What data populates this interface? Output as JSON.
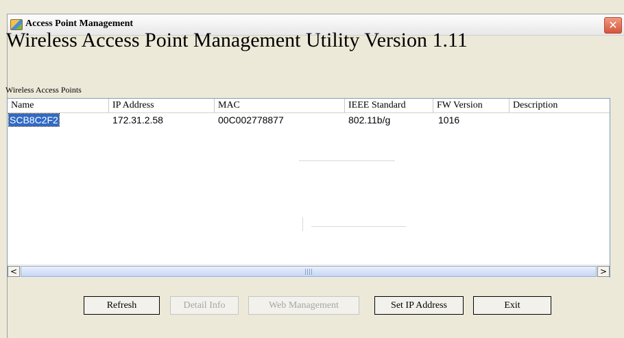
{
  "window": {
    "title": "Access Point Management",
    "close_icon": "close-icon",
    "app_icon": "network-icon"
  },
  "heading": "Wireless Access Point Management Utility Version 1.11",
  "group_label": "Wireless Access Points",
  "table": {
    "columns": [
      "Name",
      "IP Address",
      "MAC",
      "IEEE Standard",
      "FW Version",
      "Description"
    ],
    "rows": [
      {
        "name": "SCB8C2F2",
        "ip": "172.31.2.58",
        "mac": "00C002778877",
        "ieee": "802.11b/g",
        "fw": "1016",
        "description": "",
        "selected": true
      }
    ]
  },
  "scrollbar": {
    "left_arrow": "<",
    "right_arrow": ">"
  },
  "buttons": {
    "refresh": "Refresh",
    "detail_info": "Detail Info",
    "web_management": "Web Management",
    "set_ip": "Set IP Address",
    "exit": "Exit"
  },
  "colors": {
    "selection": "#316ac5",
    "close": "#d6543a"
  }
}
